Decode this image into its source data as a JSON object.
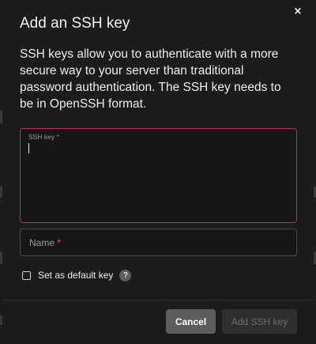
{
  "dialog": {
    "title": "Add an SSH key",
    "close_symbol": "×",
    "description": "SSH keys allow you to authenticate with a more secure way to your server than traditional password authentication. The SSH key needs to be in OpenSSH format."
  },
  "ssh_key_field": {
    "label": "SSH key",
    "required_mark": "*",
    "value": ""
  },
  "name_field": {
    "placeholder": "Name",
    "required_mark": "*",
    "value": ""
  },
  "default_key_checkbox": {
    "label": "Set as default key",
    "checked": false,
    "help_symbol": "?"
  },
  "footer": {
    "cancel_label": "Cancel",
    "add_label": "Add SSH key",
    "add_enabled": false
  },
  "icons": {
    "close": "close-icon",
    "help": "question-mark-icon"
  },
  "colors": {
    "background": "#1c1c1c",
    "error_border": "#b5343d",
    "required_asterisk": "#e55a63",
    "cancel_button": "#5d5d5d",
    "disabled_button": "#2f2f2f"
  }
}
